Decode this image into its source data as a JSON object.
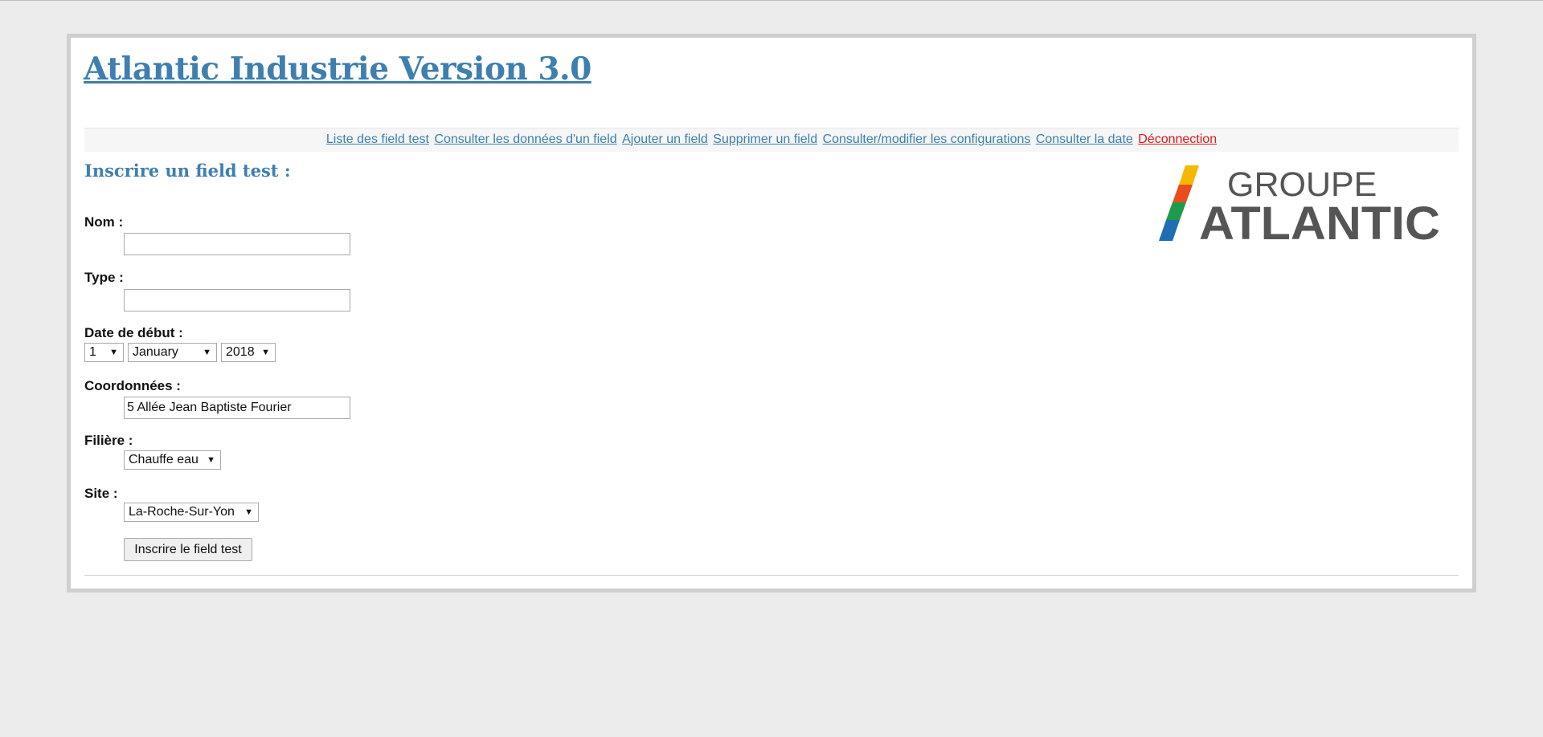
{
  "header": {
    "title": "Atlantic Industrie Version 3.0"
  },
  "nav": {
    "items": [
      "Liste des field test",
      "Consulter les données d'un field",
      "Ajouter un field",
      "Supprimer un field",
      "Consulter/modifier les configurations",
      "Consulter la date"
    ],
    "logout": "Déconnection",
    "link_color": "#3e7fae",
    "logout_color": "#e01818"
  },
  "logo": {
    "line1": "GROUPE",
    "line2": "ATLANTIC",
    "stripe_colors": [
      "#f5b800",
      "#e84e1b",
      "#1f9a4a",
      "#1f6db5"
    ],
    "text_color": "#555555"
  },
  "form": {
    "title": "Inscrire un field test :",
    "nom": {
      "label": "Nom :",
      "value": ""
    },
    "type": {
      "label": "Type :",
      "value": ""
    },
    "date": {
      "label": "Date de début :",
      "day": "1",
      "month": "January",
      "year": "2018"
    },
    "coords": {
      "label": "Coordonnées :",
      "value": "5 Allée Jean Baptiste Fourier"
    },
    "filiere": {
      "label": "Filière :",
      "value": "Chauffe eau"
    },
    "site": {
      "label": "Site :",
      "value": "La-Roche-Sur-Yon"
    },
    "submit_label": "Inscrire le field test"
  }
}
